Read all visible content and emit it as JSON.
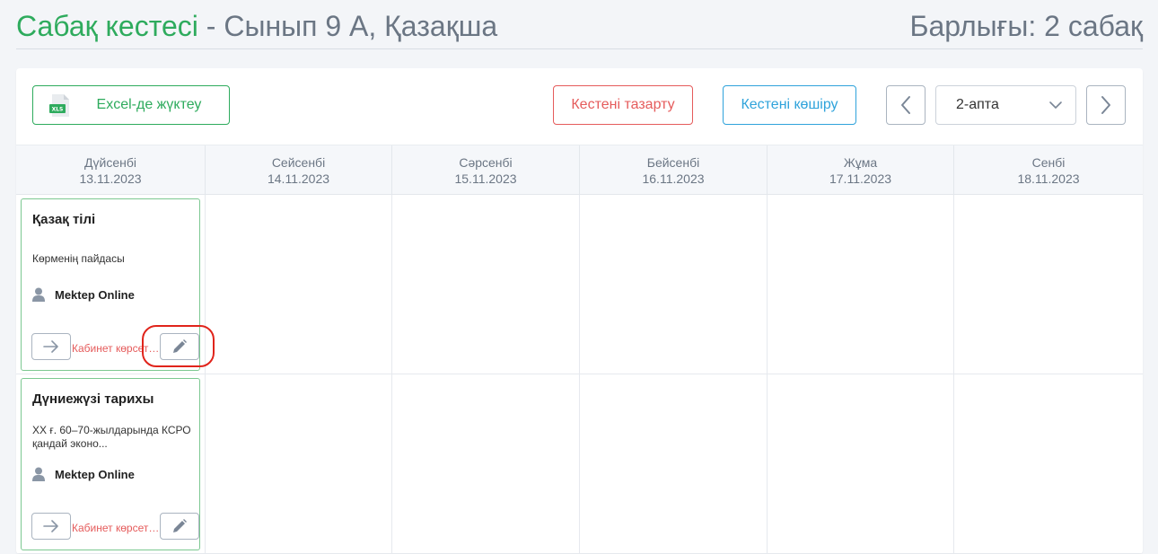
{
  "header": {
    "title_main": "Сабақ кестесі",
    "title_sub": " - Сынып 9 А, Қазақша",
    "total": "Барлығы: 2 сабақ"
  },
  "toolbar": {
    "excel_label": "Excel-де жүктеу",
    "excel_icon_text": "XLS",
    "clear_label": "Кестені тазарту",
    "copy_label": "Кестені көшіру",
    "week_value": "2-апта"
  },
  "days": [
    {
      "name": "Дүйсенбі",
      "date": "13.11.2023"
    },
    {
      "name": "Сейсенбі",
      "date": "14.11.2023"
    },
    {
      "name": "Сәрсенбі",
      "date": "15.11.2023"
    },
    {
      "name": "Бейсенбі",
      "date": "16.11.2023"
    },
    {
      "name": "Жұма",
      "date": "17.11.2023"
    },
    {
      "name": "Сенбі",
      "date": "18.11.2023"
    }
  ],
  "lessons": [
    {
      "subject": "Қазақ тілі",
      "topic": "Көрменің пайдасы",
      "teacher": "Mektep Online",
      "room": "Кабинет көрсетілмеген"
    },
    {
      "subject": "Дүниежүзі тарихы",
      "topic": "XX ғ. 60–70-жылдарында КСРО қандай эконо...",
      "teacher": "Mektep Online",
      "room": "Кабинет көрсетілмеген"
    }
  ],
  "colors": {
    "accent_green": "#2eab5d",
    "danger_red": "#e55b5b",
    "info_blue": "#2fa3db",
    "highlight": "#e0241b"
  }
}
